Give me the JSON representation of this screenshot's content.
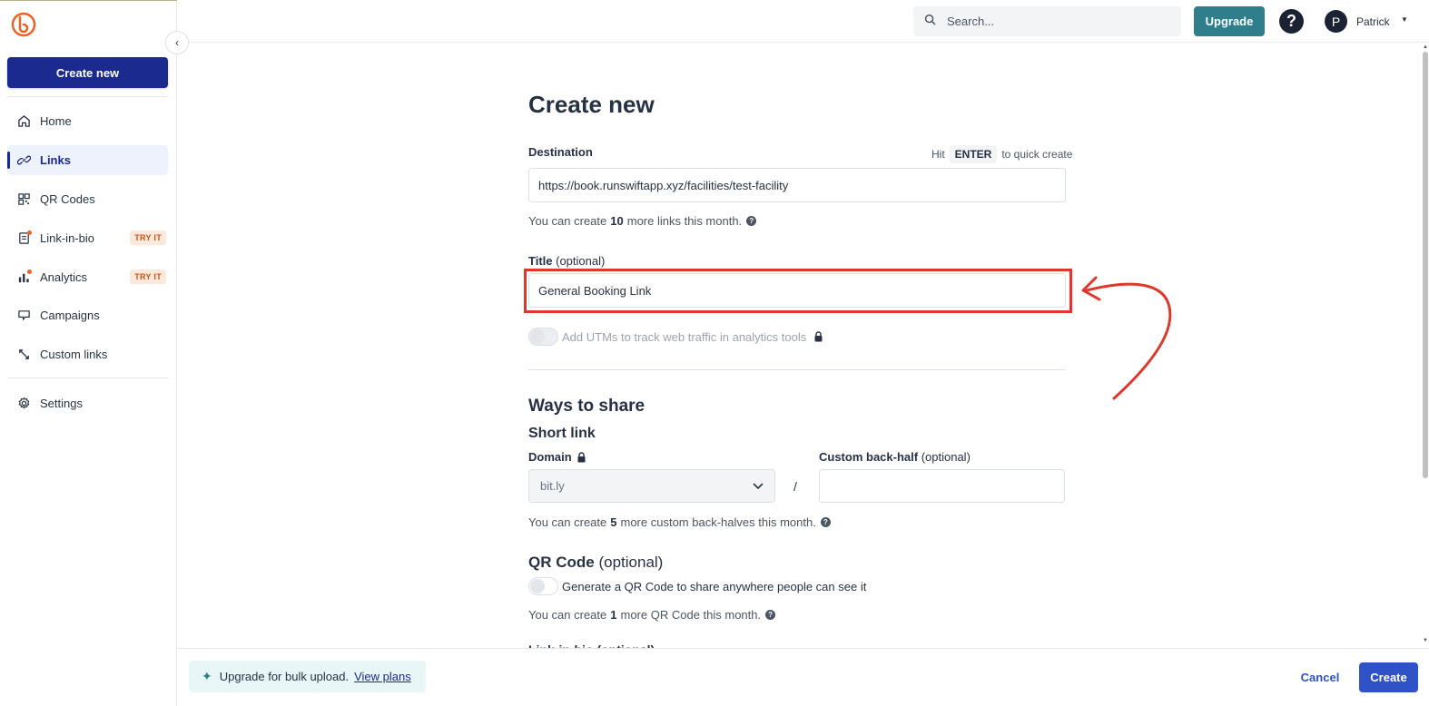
{
  "sidebar": {
    "create_new": "Create new",
    "items": [
      {
        "label": "Home",
        "icon": "home-icon"
      },
      {
        "label": "Links",
        "icon": "link-icon",
        "active": true
      },
      {
        "label": "QR Codes",
        "icon": "qr-code-icon"
      },
      {
        "label": "Link-in-bio",
        "icon": "link-in-bio-icon",
        "badge": "TRY IT"
      },
      {
        "label": "Analytics",
        "icon": "analytics-icon",
        "badge": "TRY IT"
      },
      {
        "label": "Campaigns",
        "icon": "campaigns-icon"
      },
      {
        "label": "Custom links",
        "icon": "custom-links-icon"
      },
      {
        "label": "Settings",
        "icon": "settings-icon"
      }
    ]
  },
  "topbar": {
    "search_placeholder": "Search...",
    "upgrade": "Upgrade",
    "help": "?",
    "avatar_initial": "P",
    "username": "Patrick"
  },
  "form": {
    "title": "Create new",
    "destination_label": "Destination",
    "hint_prefix": "Hit",
    "hint_key": "ENTER",
    "hint_suffix": "to quick create",
    "destination_value": "https://book.runswiftapp.xyz/facilities/test-facility",
    "links_limit_prefix": "You can create",
    "links_limit_count": "10",
    "links_limit_suffix": "more links this month.",
    "title_label": "Title",
    "title_optional": "(optional)",
    "title_value": "General Booking Link",
    "utm_label": "Add UTMs to track web traffic in analytics tools",
    "share_title": "Ways to share",
    "short_link_title": "Short link",
    "domain_label": "Domain",
    "domain_value": "bit.ly",
    "slash": "/",
    "backhalf_label": "Custom back-half",
    "backhalf_optional": "(optional)",
    "backhalf_value": "",
    "backhalf_limit_prefix": "You can create",
    "backhalf_limit_count": "5",
    "backhalf_limit_suffix": "more custom back-halves this month.",
    "qr_title": "QR Code",
    "qr_optional": "(optional)",
    "qr_toggle_label": "Generate a QR Code to share anywhere people can see it",
    "qr_limit_prefix": "You can create",
    "qr_limit_count": "1",
    "qr_limit_suffix": "more QR Code this month.",
    "cut_off_text": "Link-in-bio (optional)"
  },
  "footer": {
    "promo_text": "Upgrade for bulk upload.",
    "promo_link": "View plans",
    "cancel": "Cancel",
    "create": "Create"
  },
  "colors": {
    "brand": "#ee6123",
    "primary_dark": "#1a2a8e",
    "primary": "#2f52c7",
    "upgrade": "#2e7e8c",
    "annotation": "#e0362c"
  }
}
